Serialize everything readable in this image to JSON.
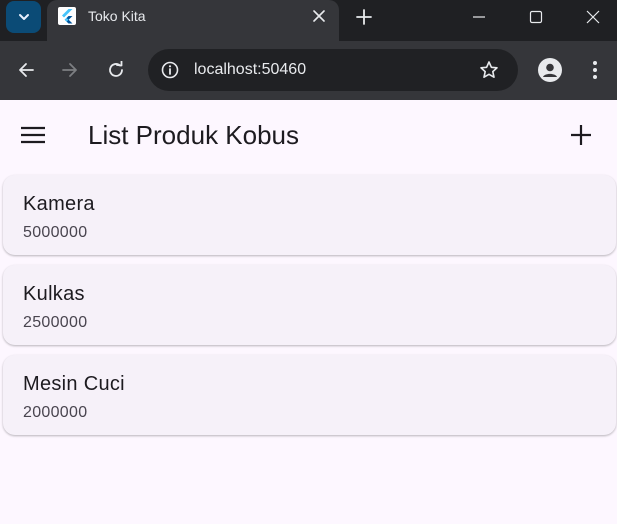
{
  "browser": {
    "tab_title": "Toko Kita",
    "url": "localhost:50460"
  },
  "app": {
    "title": "List Produk Kobus",
    "products": [
      {
        "name": "Kamera",
        "price": "5000000"
      },
      {
        "name": "Kulkas",
        "price": "2500000"
      },
      {
        "name": "Mesin Cuci",
        "price": "2000000"
      }
    ]
  },
  "colors": {
    "tabstrip_bg": "#1f2023",
    "toolbar_bg": "#35363a",
    "app_bg": "#fdf7ff",
    "card_bg": "#f6f1f9",
    "text_primary": "#1d1b20"
  },
  "icons": {
    "tab_search": "chevron-down-icon",
    "favicon": "flutter-icon",
    "tab_close": "close-icon",
    "new_tab": "plus-icon",
    "back": "arrow-left-icon",
    "forward": "arrow-right-icon",
    "reload": "reload-icon",
    "site_info": "info-icon",
    "bookmark": "star-icon",
    "profile": "person-icon",
    "browser_menu": "kebab-icon",
    "app_menu": "hamburger-icon",
    "app_add": "plus-icon"
  }
}
